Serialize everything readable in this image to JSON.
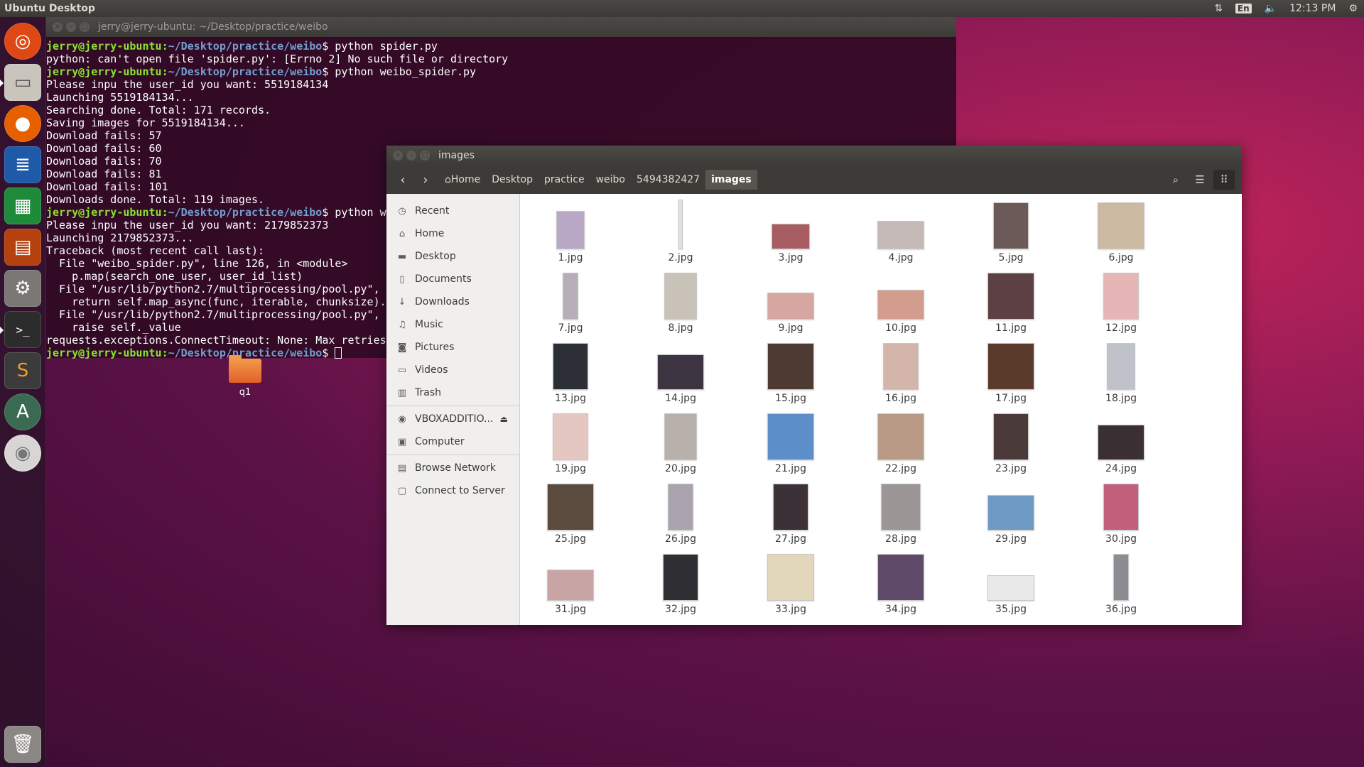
{
  "topbar": {
    "title": "Ubuntu Desktop",
    "lang": "En",
    "time": "12:13 PM"
  },
  "launcher": {
    "items": [
      "dash-icon",
      "files-icon",
      "firefox-icon",
      "writer-icon",
      "calc-icon",
      "impress-icon",
      "settings-icon",
      "terminal-icon",
      "sublime-icon",
      "software-updater-icon",
      "dvd-icon",
      "trash-icon"
    ]
  },
  "terminal": {
    "title": "jerry@jerry-ubuntu: ~/Desktop/practice/weibo",
    "user": "jerry@jerry-ubuntu",
    "path": "~/Desktop/practice/weibo",
    "lines": [
      {
        "prompt": true,
        "cmd": "python spider.py"
      },
      {
        "text": "python: can't open file 'spider.py': [Errno 2] No such file or directory"
      },
      {
        "prompt": true,
        "cmd": "python weibo_spider.py"
      },
      {
        "text": "Please inpu the user_id you want: 5519184134"
      },
      {
        "text": "Launching 5519184134..."
      },
      {
        "text": "Searching done. Total: 171 records."
      },
      {
        "text": "Saving images for 5519184134..."
      },
      {
        "text": "Download fails: 57"
      },
      {
        "text": "Download fails: 60"
      },
      {
        "text": "Download fails: 70"
      },
      {
        "text": "Download fails: 81"
      },
      {
        "text": "Download fails: 101"
      },
      {
        "text": "Downloads done. Total: 119 images."
      },
      {
        "prompt": true,
        "cmd": "python w"
      },
      {
        "text": "Please inpu the user_id you want: 2179852373"
      },
      {
        "text": "Launching 2179852373..."
      },
      {
        "text": "Traceback (most recent call last):"
      },
      {
        "text": "  File \"weibo_spider.py\", line 126, in <module>"
      },
      {
        "text": "    p.map(search_one_user, user_id_list)"
      },
      {
        "text": "  File \"/usr/lib/python2.7/multiprocessing/pool.py\","
      },
      {
        "text": "    return self.map_async(func, iterable, chunksize)."
      },
      {
        "text": "  File \"/usr/lib/python2.7/multiprocessing/pool.py\","
      },
      {
        "text": "    raise self._value"
      },
      {
        "text": "requests.exceptions.ConnectTimeout: None: Max retries"
      },
      {
        "prompt": true,
        "cmd": "",
        "cursor": true
      }
    ]
  },
  "desktop_folder": {
    "label": "q1"
  },
  "file_manager": {
    "title": "images",
    "breadcrumbs": [
      "Home",
      "Desktop",
      "practice",
      "weibo",
      "5494382427",
      "images"
    ],
    "sidebar": [
      {
        "label": "Recent",
        "icon": "clock-icon"
      },
      {
        "label": "Home",
        "icon": "home-icon"
      },
      {
        "label": "Desktop",
        "icon": "desktop-folder-icon"
      },
      {
        "label": "Documents",
        "icon": "document-icon"
      },
      {
        "label": "Downloads",
        "icon": "download-icon"
      },
      {
        "label": "Music",
        "icon": "music-icon"
      },
      {
        "label": "Pictures",
        "icon": "camera-icon"
      },
      {
        "label": "Videos",
        "icon": "video-icon"
      },
      {
        "label": "Trash",
        "icon": "trash-icon"
      },
      {
        "label": "VBOXADDITIO...",
        "icon": "disc-icon",
        "eject": true
      },
      {
        "label": "Computer",
        "icon": "computer-icon"
      },
      {
        "label": "Browse Network",
        "icon": "network-icon"
      },
      {
        "label": "Connect to Server",
        "icon": "server-icon"
      }
    ],
    "files": [
      {
        "name": "1.jpg",
        "w": 40,
        "h": 54,
        "color": "#b9a7c6"
      },
      {
        "name": "2.jpg",
        "w": 6,
        "h": 70,
        "color": "#e0e0e0"
      },
      {
        "name": "3.jpg",
        "w": 54,
        "h": 36,
        "color": "#a75c62"
      },
      {
        "name": "4.jpg",
        "w": 66,
        "h": 40,
        "color": "#c5b9b8"
      },
      {
        "name": "5.jpg",
        "w": 50,
        "h": 66,
        "color": "#6b5a57"
      },
      {
        "name": "6.jpg",
        "w": 66,
        "h": 66,
        "color": "#cbb9a1"
      },
      {
        "name": "7.jpg",
        "w": 22,
        "h": 66,
        "color": "#b7adb8"
      },
      {
        "name": "8.jpg",
        "w": 46,
        "h": 66,
        "color": "#c9c2b9"
      },
      {
        "name": "9.jpg",
        "w": 66,
        "h": 38,
        "color": "#d6a7a1"
      },
      {
        "name": "10.jpg",
        "w": 66,
        "h": 42,
        "color": "#d29c8e"
      },
      {
        "name": "11.jpg",
        "w": 66,
        "h": 66,
        "color": "#5c4043"
      },
      {
        "name": "12.jpg",
        "w": 50,
        "h": 66,
        "color": "#e6b6b6"
      },
      {
        "name": "13.jpg",
        "w": 50,
        "h": 66,
        "color": "#2d2f36"
      },
      {
        "name": "14.jpg",
        "w": 66,
        "h": 50,
        "color": "#3c3440"
      },
      {
        "name": "15.jpg",
        "w": 66,
        "h": 66,
        "color": "#4d3a32"
      },
      {
        "name": "16.jpg",
        "w": 50,
        "h": 66,
        "color": "#d3b5a9"
      },
      {
        "name": "17.jpg",
        "w": 66,
        "h": 66,
        "color": "#5a3a2a"
      },
      {
        "name": "18.jpg",
        "w": 40,
        "h": 66,
        "color": "#c0c2c9"
      },
      {
        "name": "19.jpg",
        "w": 50,
        "h": 66,
        "color": "#e3c7c0"
      },
      {
        "name": "20.jpg",
        "w": 46,
        "h": 66,
        "color": "#b7b0ab"
      },
      {
        "name": "21.jpg",
        "w": 66,
        "h": 66,
        "color": "#5c8ec9"
      },
      {
        "name": "22.jpg",
        "w": 66,
        "h": 66,
        "color": "#b89a86"
      },
      {
        "name": "23.jpg",
        "w": 50,
        "h": 66,
        "color": "#4a3b3a"
      },
      {
        "name": "24.jpg",
        "w": 66,
        "h": 50,
        "color": "#3a2f33"
      },
      {
        "name": "25.jpg",
        "w": 66,
        "h": 66,
        "color": "#5b4a3e"
      },
      {
        "name": "26.jpg",
        "w": 36,
        "h": 66,
        "color": "#aaa3ae"
      },
      {
        "name": "27.jpg",
        "w": 50,
        "h": 66,
        "color": "#3b3137"
      },
      {
        "name": "28.jpg",
        "w": 56,
        "h": 66,
        "color": "#9c9696"
      },
      {
        "name": "29.jpg",
        "w": 66,
        "h": 50,
        "color": "#6d9bc4"
      },
      {
        "name": "30.jpg",
        "w": 50,
        "h": 66,
        "color": "#c0607a"
      },
      {
        "name": "31.jpg",
        "w": 66,
        "h": 44,
        "color": "#c8a4a4"
      },
      {
        "name": "32.jpg",
        "w": 50,
        "h": 66,
        "color": "#2f2e33"
      },
      {
        "name": "33.jpg",
        "w": 66,
        "h": 66,
        "color": "#e3d7bb"
      },
      {
        "name": "34.jpg",
        "w": 66,
        "h": 66,
        "color": "#5f4a6a"
      },
      {
        "name": "35.jpg",
        "w": 66,
        "h": 36,
        "color": "#e9e9e9"
      },
      {
        "name": "36.jpg",
        "w": 22,
        "h": 66,
        "color": "#8f8b92"
      }
    ]
  }
}
